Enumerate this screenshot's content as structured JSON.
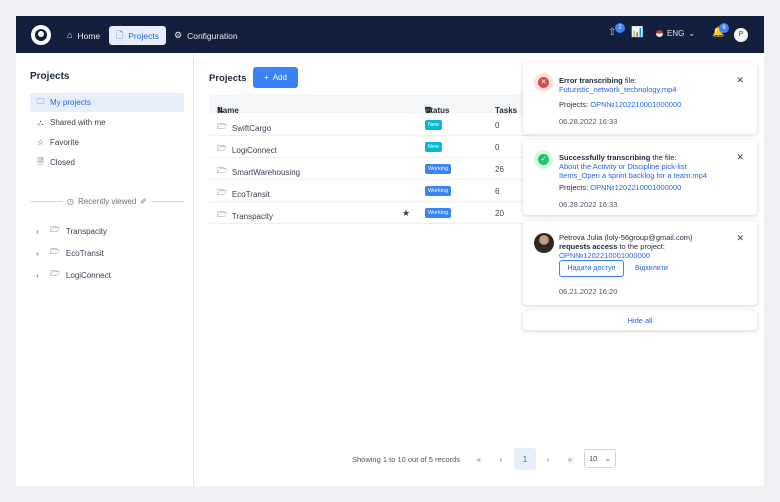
{
  "topbar": {
    "nav": [
      {
        "label": "Home",
        "icon": "home-icon"
      },
      {
        "label": "Projects",
        "icon": "document-icon"
      },
      {
        "label": "Configuration",
        "icon": "gear-icon"
      }
    ],
    "upload_badge": "2",
    "lang": "ENG",
    "notif_badge": "6",
    "avatar_initial": "P"
  },
  "sidebar": {
    "title": "Projects",
    "items": [
      {
        "label": "My projects",
        "icon": "folder-icon"
      },
      {
        "label": "Shared with me",
        "icon": "shared-icon"
      },
      {
        "label": "Favorite",
        "icon": "star-icon"
      },
      {
        "label": "Closed",
        "icon": "closed-doc-icon"
      }
    ],
    "recently_viewed": "Recently viewed",
    "tree": [
      "Transpacity",
      "EcoTransit",
      "LogiConnect"
    ]
  },
  "main": {
    "title": "Projects",
    "add_label": "Add",
    "columns": {
      "name": "Name",
      "status": "Status",
      "tasks": "Tasks"
    },
    "rows": [
      {
        "name": "SwiftCargo",
        "status": "New",
        "tasks": "0",
        "favorite": false
      },
      {
        "name": "LogiConnect",
        "status": "New",
        "tasks": "0",
        "favorite": false
      },
      {
        "name": "SmartWarehousing",
        "status": "Working",
        "tasks": "26",
        "favorite": false
      },
      {
        "name": "EcoTransit",
        "status": "Working",
        "tasks": "6",
        "favorite": false
      },
      {
        "name": "Transpacity",
        "status": "Working",
        "tasks": "20",
        "favorite": true
      }
    ],
    "status_colors": {
      "New": "#06b6d4",
      "Working": "#3b82f6"
    }
  },
  "pagination": {
    "summary": "Showing 1 to 10 out of 5 records",
    "current": "1",
    "page_size": "10"
  },
  "notifications": [
    {
      "type": "error",
      "title_bold": "Error transcribing",
      "title_rest": " file:",
      "file": "Futuristic_network_technology.mp4",
      "projects_label": "Projects: ",
      "project_id": "OPN№1202210001000000",
      "date": "06.28.2022 16:33"
    },
    {
      "type": "success",
      "title_bold": "Successfully transcribing",
      "title_rest": " the file:",
      "file_line1": "About the Activity or Discipline pick-list",
      "file_line2": "Items_Open a sprint backlog for a team.mp4",
      "projects_label": "Projects: ",
      "project_id": "OPN№1202210001000000",
      "date": "06.28.2022 16:33"
    },
    {
      "type": "access",
      "user": "Petrova Julia (loly-56group@gmail.com)",
      "action_bold": "requests access",
      "action_rest": " to the project:",
      "project_id": "OPN№1202210001000000",
      "grant_label": "Надати доступ",
      "reject_label": "Відхилити",
      "date": "06.21.2022 16:20"
    }
  ],
  "hide_all": "Hide all"
}
